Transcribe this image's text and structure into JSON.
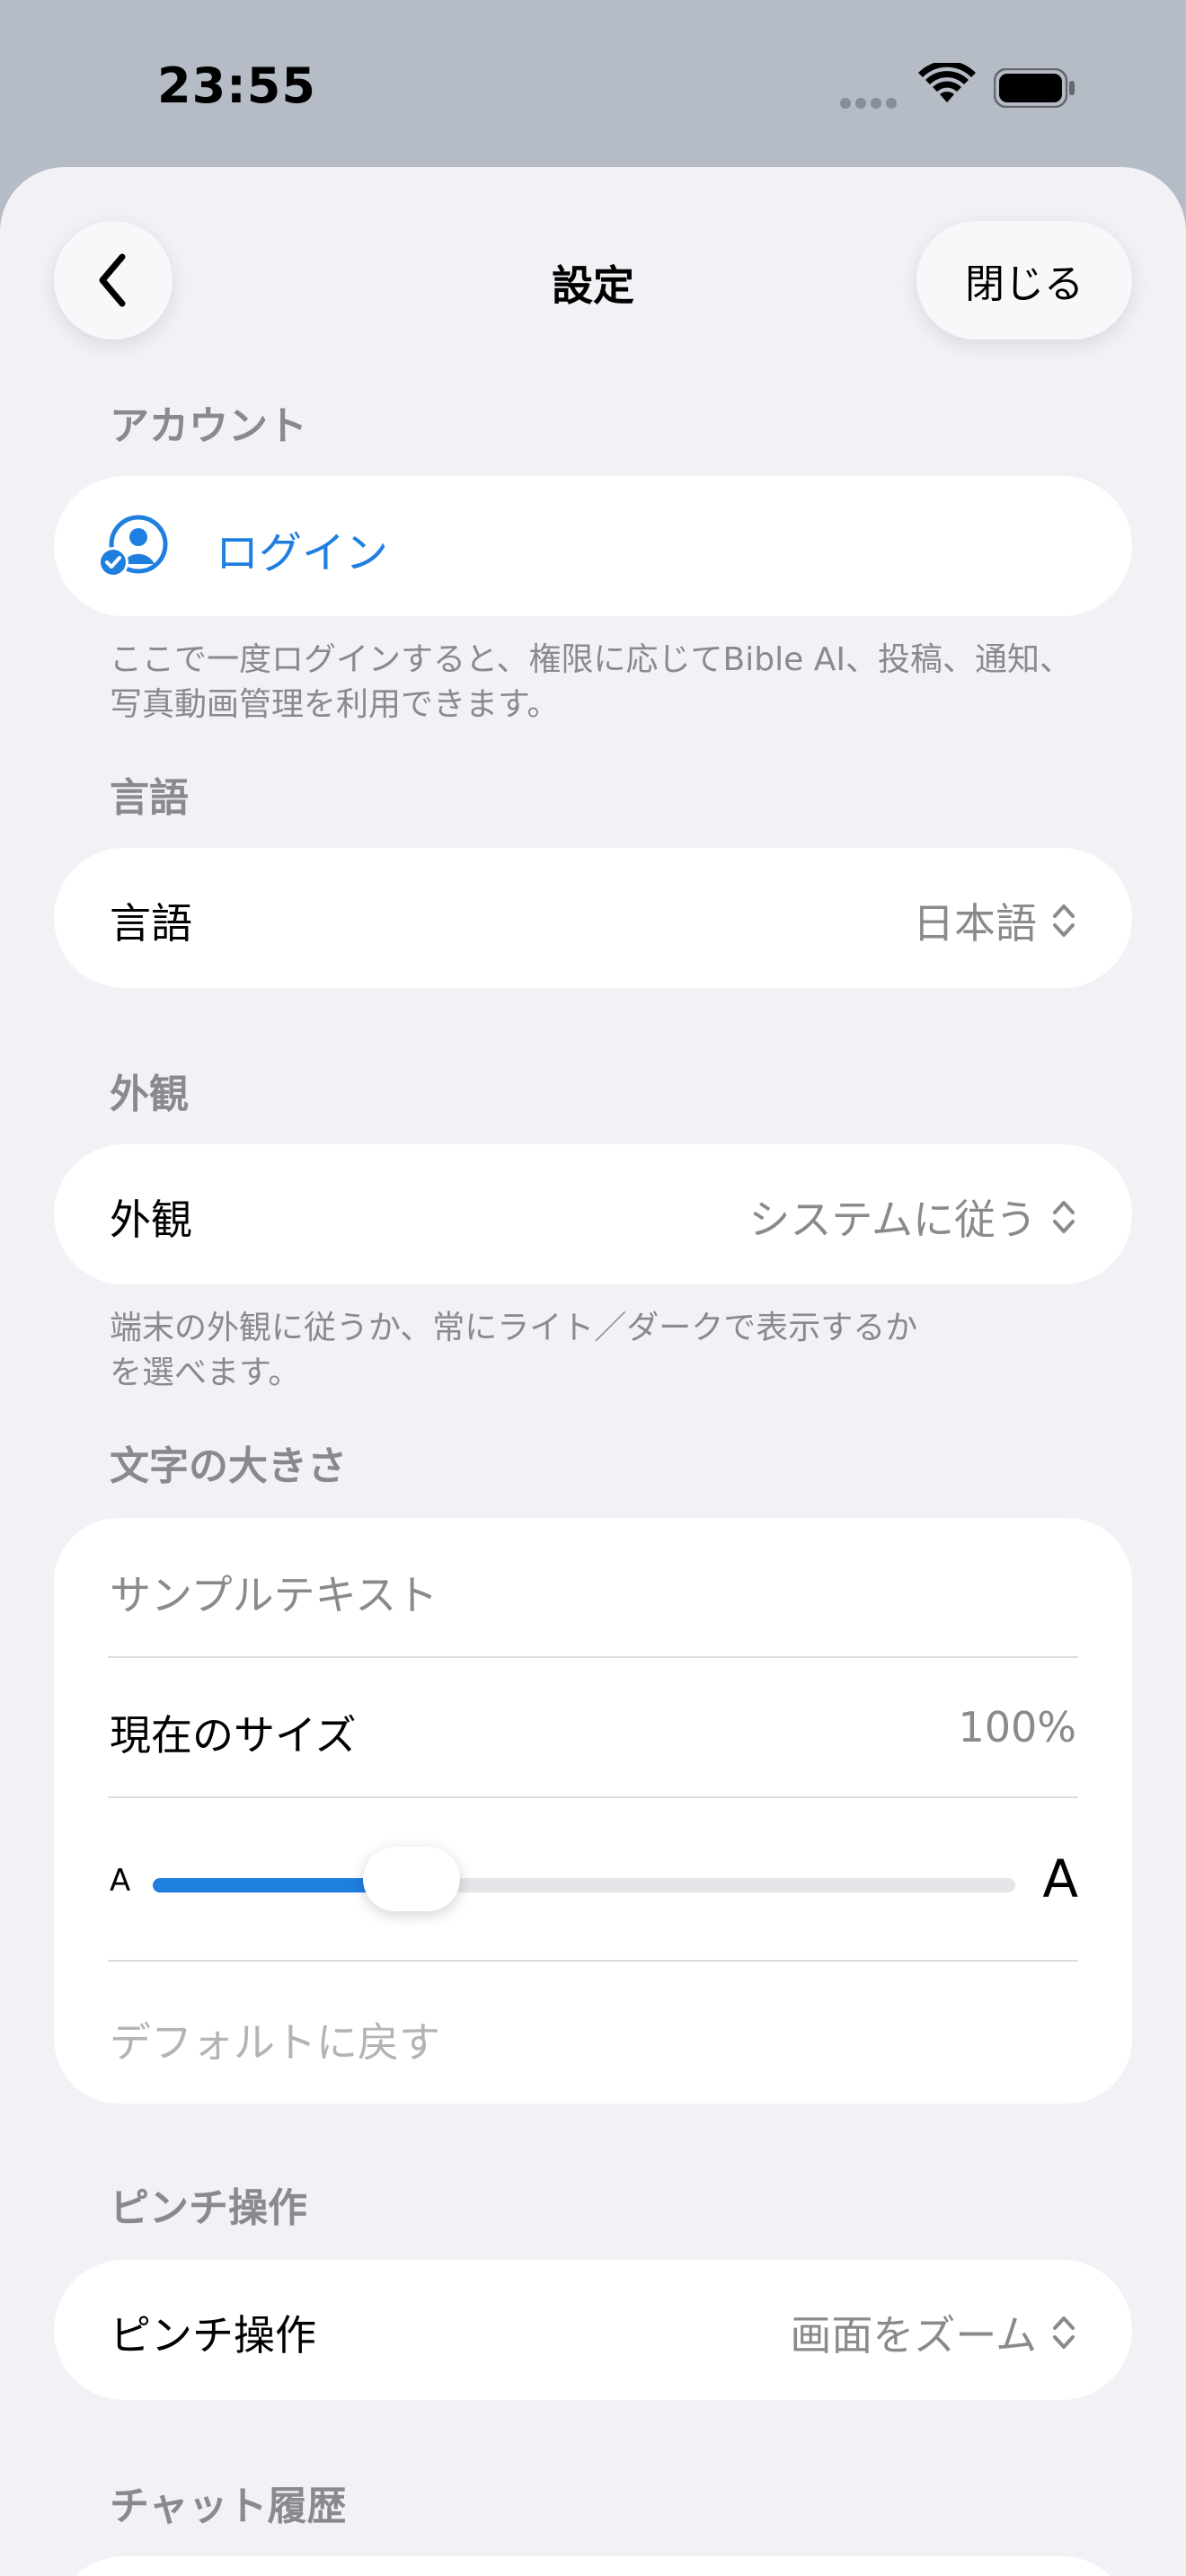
{
  "status_bar": {
    "time": "23:55"
  },
  "nav": {
    "title": "設定",
    "close_label": "閉じる"
  },
  "account": {
    "header": "アカウント",
    "login_label": "ログイン",
    "footnote": "ここで一度ログインすると、権限に応じてBible AI、投稿、通知、写真動画管理を利用できます。"
  },
  "language": {
    "header": "言語",
    "label": "言語",
    "value": "日本語"
  },
  "appearance": {
    "header": "外観",
    "label": "外観",
    "value": "システムに従う",
    "footnote": "端末の外観に従うか、常にライト／ダークで表示するかを選べます。"
  },
  "text_size": {
    "header": "文字の大きさ",
    "sample_text": "サンプルテキスト",
    "current_label": "現在のサイズ",
    "current_value": "100%",
    "small_glyph": "A",
    "large_glyph": "A",
    "slider_fraction": 0.3,
    "reset_label": "デフォルトに戻す"
  },
  "pinch": {
    "header": "ピンチ操作",
    "label": "ピンチ操作",
    "value": "画面をズーム"
  },
  "chat_history": {
    "header": "チャット履歴"
  },
  "colors": {
    "accent": "#1f7fe0",
    "secondary_text": "#8a8a8e",
    "background": "#f1f1f6"
  }
}
